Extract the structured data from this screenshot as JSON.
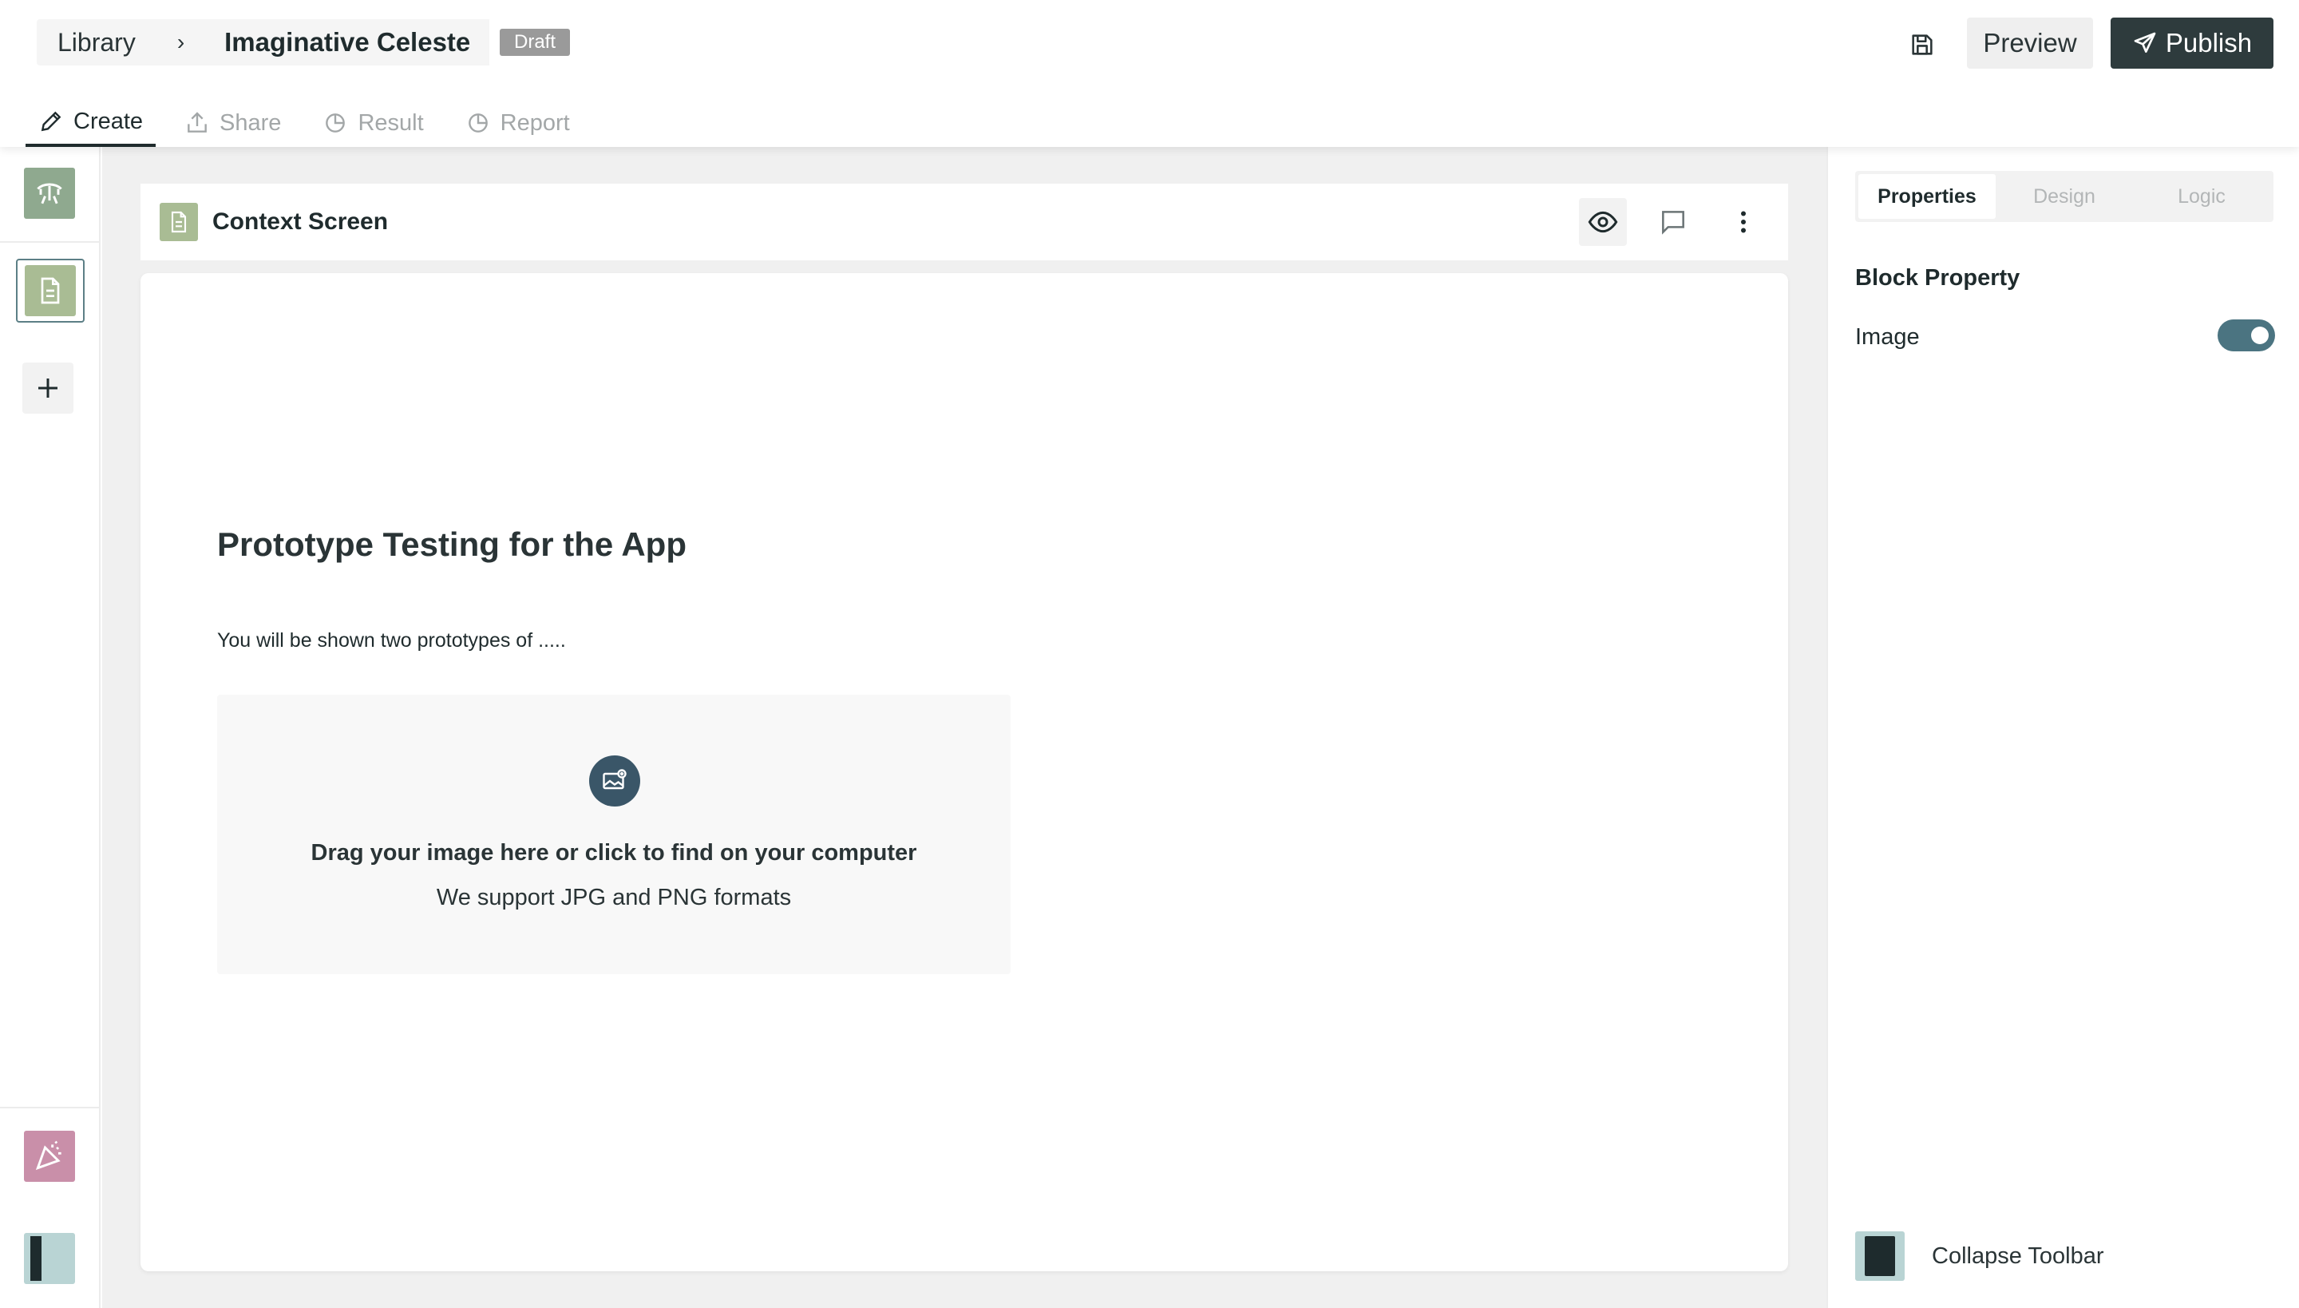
{
  "breadcrumb": {
    "library": "Library",
    "separator": "›",
    "title": "Imaginative Celeste",
    "status_badge": "Draft"
  },
  "header_actions": {
    "preview": "Preview",
    "publish": "Publish"
  },
  "tabs": [
    {
      "label": "Create",
      "icon": "pencil-icon",
      "active": true
    },
    {
      "label": "Share",
      "icon": "share-icon",
      "active": false
    },
    {
      "label": "Result",
      "icon": "pie-chart-icon",
      "active": false
    },
    {
      "label": "Report",
      "icon": "pie-chart-icon",
      "active": false
    }
  ],
  "block": {
    "header_title": "Context Screen",
    "title": "Prototype Testing for the App",
    "text": "You will be shown two prototypes of .....",
    "dropzone": {
      "main": "Drag your image here or click to find on your computer",
      "sub": "We support JPG and PNG formats"
    }
  },
  "panel": {
    "tabs": [
      {
        "label": "Properties",
        "active": true
      },
      {
        "label": "Design",
        "active": false
      },
      {
        "label": "Logic",
        "active": false
      }
    ],
    "section_title": "Block Property",
    "image_label": "Image",
    "image_enabled": true,
    "collapse_label": "Collapse Toolbar"
  },
  "colors": {
    "primary_dark": "#2e3b3d",
    "toggle_on": "#4b7481",
    "thumb_green": "#a9bc94",
    "thumb_pink": "#c98fa9",
    "upload_icon": "#3a5668"
  }
}
